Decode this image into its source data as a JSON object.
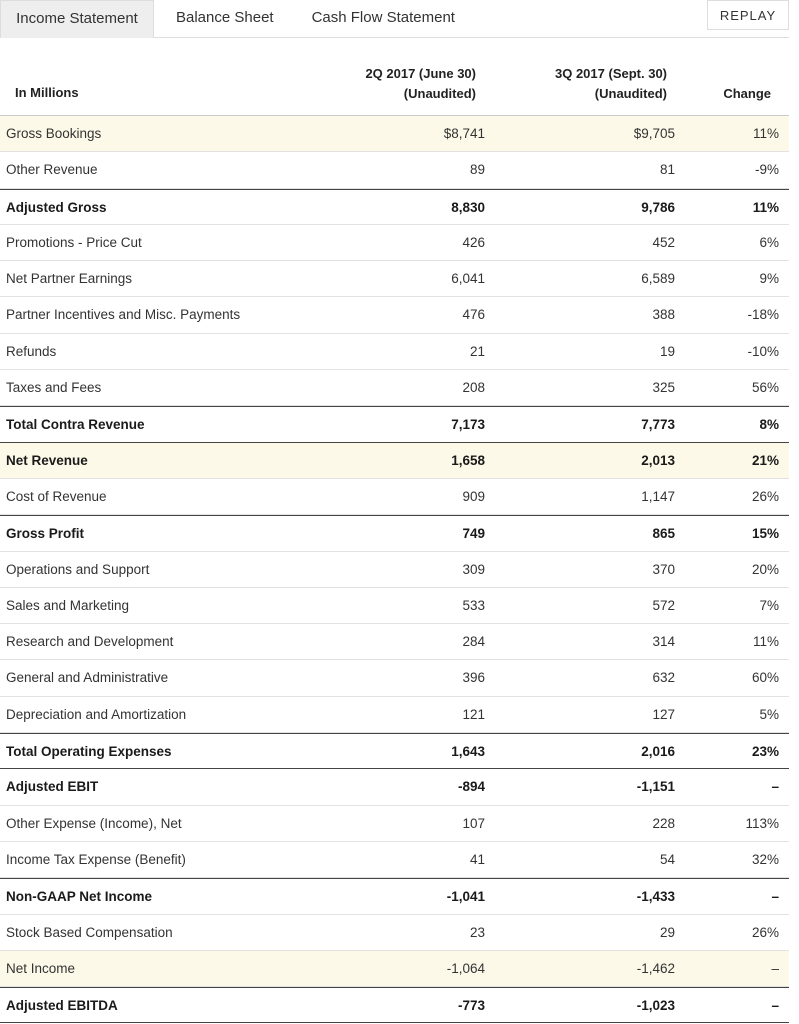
{
  "tabs": [
    {
      "label": "Income Statement",
      "active": true
    },
    {
      "label": "Balance Sheet",
      "active": false
    },
    {
      "label": "Cash Flow Statement",
      "active": false
    }
  ],
  "replay_label": "REPLAY",
  "table": {
    "header": {
      "label": "In Millions",
      "col1_line1": "2Q 2017 (June 30)",
      "col1_line2": "(Unaudited)",
      "col2_line1": "3Q 2017 (Sept. 30)",
      "col2_line2": "(Unaudited)",
      "col3": "Change"
    },
    "rows": [
      {
        "label": "Gross Bookings",
        "q2": "$8,741",
        "q3": "$9,705",
        "change": "11%"
      },
      {
        "label": "Other Revenue",
        "q2": "89",
        "q3": "81",
        "change": "-9%"
      },
      {
        "label": "Adjusted Gross",
        "q2": "8,830",
        "q3": "9,786",
        "change": "11%"
      },
      {
        "label": "Promotions - Price Cut",
        "q2": "426",
        "q3": "452",
        "change": "6%"
      },
      {
        "label": "Net Partner Earnings",
        "q2": "6,041",
        "q3": "6,589",
        "change": "9%"
      },
      {
        "label": "Partner Incentives and Misc. Payments",
        "q2": "476",
        "q3": "388",
        "change": "-18%"
      },
      {
        "label": "Refunds",
        "q2": "21",
        "q3": "19",
        "change": "-10%"
      },
      {
        "label": "Taxes and Fees",
        "q2": "208",
        "q3": "325",
        "change": "56%"
      },
      {
        "label": "Total Contra Revenue",
        "q2": "7,173",
        "q3": "7,773",
        "change": "8%"
      },
      {
        "label": "Net Revenue",
        "q2": "1,658",
        "q3": "2,013",
        "change": "21%"
      },
      {
        "label": "Cost of Revenue",
        "q2": "909",
        "q3": "1,147",
        "change": "26%"
      },
      {
        "label": "Gross Profit",
        "q2": "749",
        "q3": "865",
        "change": "15%"
      },
      {
        "label": "Operations and Support",
        "q2": "309",
        "q3": "370",
        "change": "20%"
      },
      {
        "label": "Sales and Marketing",
        "q2": "533",
        "q3": "572",
        "change": "7%"
      },
      {
        "label": "Research and Development",
        "q2": "284",
        "q3": "314",
        "change": "11%"
      },
      {
        "label": "General and Administrative",
        "q2": "396",
        "q3": "632",
        "change": "60%"
      },
      {
        "label": "Depreciation and Amortization",
        "q2": "121",
        "q3": "127",
        "change": "5%"
      },
      {
        "label": "Total Operating Expenses",
        "q2": "1,643",
        "q3": "2,016",
        "change": "23%"
      },
      {
        "label": "Adjusted EBIT",
        "q2": "-894",
        "q3": "-1,151",
        "change": "–"
      },
      {
        "label": "Other Expense (Income), Net",
        "q2": "107",
        "q3": "228",
        "change": "113%"
      },
      {
        "label": "Income Tax Expense (Benefit)",
        "q2": "41",
        "q3": "54",
        "change": "32%"
      },
      {
        "label": "Non-GAAP Net Income",
        "q2": "-1,041",
        "q3": "-1,433",
        "change": "–"
      },
      {
        "label": "Stock Based Compensation",
        "q2": "23",
        "q3": "29",
        "change": "26%"
      },
      {
        "label": "Net Income",
        "q2": "-1,064",
        "q3": "-1,462",
        "change": "–"
      },
      {
        "label": "Adjusted EBITDA",
        "q2": "-773",
        "q3": "-1,023",
        "change": "–"
      }
    ]
  },
  "colors": {
    "highlight_row": "#fdf9e8",
    "active_tab": "#eeeeee",
    "rule": "#444444"
  }
}
